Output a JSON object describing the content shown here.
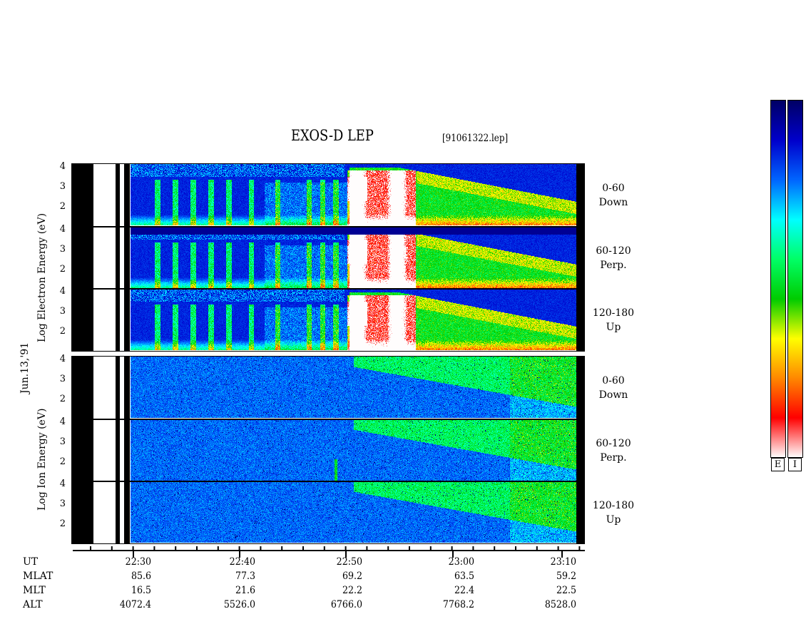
{
  "title": "EXOS-D LEP",
  "filename": "[91061322.lep]",
  "date_label": "Jun.13,'91",
  "electron_ylabel": "Log   Electron   Energy (eV)",
  "ion_ylabel": "Log   Ion   Energy (eV)",
  "pitch_panels": [
    {
      "range": "0-60",
      "dir": "Down"
    },
    {
      "range": "60-120",
      "dir": "Perp."
    },
    {
      "range": "120-180",
      "dir": "Up"
    },
    {
      "range": "0-60",
      "dir": "Down"
    },
    {
      "range": "60-120",
      "dir": "Perp."
    },
    {
      "range": "120-180",
      "dir": "Up"
    }
  ],
  "ephemeris": {
    "row_labels": [
      "UT",
      "MLAT",
      "MLT",
      "ALT"
    ],
    "columns": [
      {
        "UT": "22:30",
        "MLAT": "85.6",
        "MLT": "16.5",
        "ALT": "4072.4"
      },
      {
        "UT": "22:40",
        "MLAT": "77.3",
        "MLT": "21.6",
        "ALT": "5526.0"
      },
      {
        "UT": "22:50",
        "MLAT": "69.2",
        "MLT": "22.2",
        "ALT": "6766.0"
      },
      {
        "UT": "23:00",
        "MLAT": "63.5",
        "MLT": "22.4",
        "ALT": "7768.2"
      },
      {
        "UT": "23:10",
        "MLAT": "59.2",
        "MLT": "22.5",
        "ALT": "8528.0"
      }
    ]
  },
  "colorbar": {
    "labels": [
      "E",
      "I"
    ]
  },
  "chart_data": {
    "type": "heatmap",
    "title": "EXOS-D LEP",
    "subtitle": "[91061322.lep]",
    "xlabel": "UT",
    "x_ticks": [
      "22:30",
      "22:40",
      "22:50",
      "23:00",
      "23:10"
    ],
    "x_range_ut": [
      "22:24",
      "23:12"
    ],
    "electron_panels": {
      "ylabel": "Log Electron Energy (eV)",
      "y_ticks": [
        4,
        3,
        2
      ],
      "ylim": [
        1,
        4
      ],
      "pitch_angles": [
        "0-60 Down",
        "60-120 Perp.",
        "120-180 Up"
      ]
    },
    "ion_panels": {
      "ylabel": "Log Ion Energy (eV)",
      "y_ticks": [
        4,
        3,
        2
      ],
      "ylim": [
        1,
        4
      ],
      "pitch_angles": [
        "0-60 Down",
        "60-120 Perp.",
        "120-180 Up"
      ]
    },
    "colormap": [
      "#000066",
      "#0000cc",
      "#0066ff",
      "#00ffff",
      "#00ff66",
      "#00cc00",
      "#ffff00",
      "#ff8800",
      "#ff0000",
      "#ffffff"
    ],
    "colorbar_labels": [
      "E",
      "I"
    ]
  }
}
